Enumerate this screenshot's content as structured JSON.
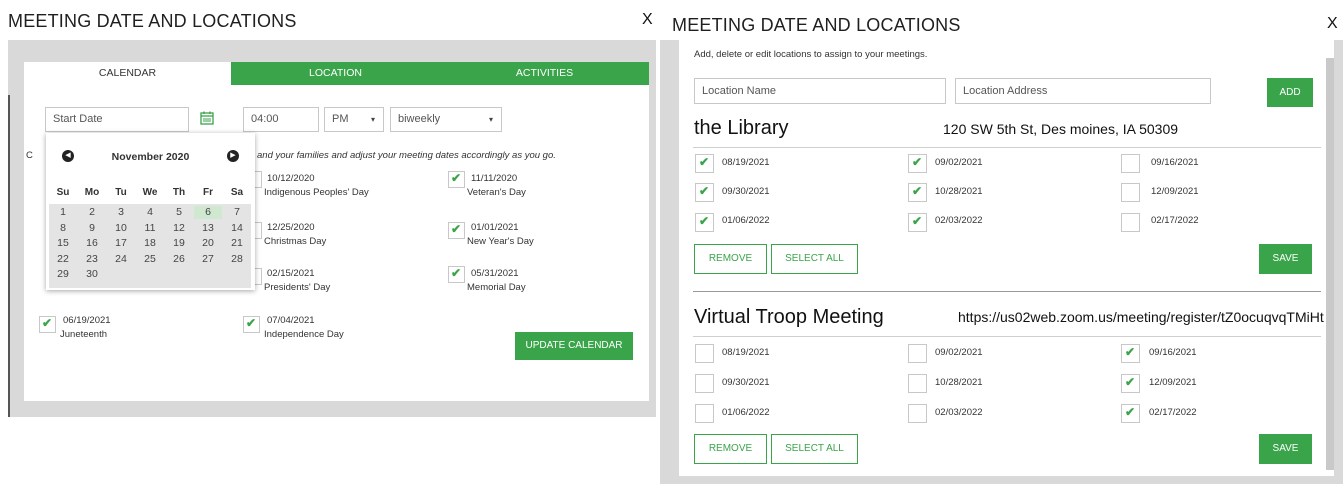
{
  "left": {
    "title": "MEETING DATE AND LOCATIONS",
    "close": "X",
    "tabs": [
      "CALENDAR",
      "LOCATION",
      "ACTIVITIES"
    ],
    "start_date_placeholder": "Start Date",
    "time": "04:00",
    "ampm": "PM",
    "frequency": "biweekly",
    "partial_c": "C",
    "instructions_partial": "and your families and adjust your meeting dates accordingly as you go.",
    "calendar": {
      "month": "November 2020",
      "dow": [
        "Su",
        "Mo",
        "Tu",
        "We",
        "Th",
        "Fr",
        "Sa"
      ],
      "weeks": [
        [
          "1",
          "2",
          "3",
          "4",
          "5",
          "6",
          "7"
        ],
        [
          "8",
          "9",
          "10",
          "11",
          "12",
          "13",
          "14"
        ],
        [
          "15",
          "16",
          "17",
          "18",
          "19",
          "20",
          "21"
        ],
        [
          "22",
          "23",
          "24",
          "25",
          "26",
          "27",
          "28"
        ],
        [
          "29",
          "30",
          "",
          "",
          "",
          "",
          ""
        ]
      ],
      "highlighted": "6"
    },
    "holidays": [
      {
        "date": "10/12/2020",
        "name": "Indigenous Peoples' Day",
        "checked": false
      },
      {
        "date": "11/11/2020",
        "name": "Veteran's Day",
        "checked": true
      },
      {
        "date": "12/25/2020",
        "name": "Christmas Day",
        "checked": false
      },
      {
        "date": "01/01/2021",
        "name": "New Year's Day",
        "checked": true
      },
      {
        "date": "02/15/2021",
        "name": "Presidents' Day",
        "checked": false
      },
      {
        "date": "05/31/2021",
        "name": "Memorial Day",
        "checked": true
      },
      {
        "date": "06/19/2021",
        "name": "Juneteenth",
        "checked": true
      },
      {
        "date": "07/04/2021",
        "name": "Independence Day",
        "checked": true
      }
    ],
    "update_button": "UPDATE CALENDAR"
  },
  "right": {
    "title": "MEETING DATE AND LOCATIONS",
    "close": "X",
    "subtitle": "Add, delete or edit locations to assign to your meetings.",
    "location_name_placeholder": "Location Name",
    "location_address_placeholder": "Location Address",
    "add_button": "ADD",
    "locations": [
      {
        "name": "the Library",
        "address": "120 SW 5th St, Des moines, IA 50309",
        "dates": [
          {
            "date": "08/19/2021",
            "checked": true
          },
          {
            "date": "09/02/2021",
            "checked": true
          },
          {
            "date": "09/16/2021",
            "checked": false
          },
          {
            "date": "09/30/2021",
            "checked": true
          },
          {
            "date": "10/28/2021",
            "checked": true
          },
          {
            "date": "12/09/2021",
            "checked": false
          },
          {
            "date": "01/06/2022",
            "checked": true
          },
          {
            "date": "02/03/2022",
            "checked": true
          },
          {
            "date": "02/17/2022",
            "checked": false
          }
        ],
        "remove": "REMOVE",
        "select_all": "SELECT ALL",
        "save": "SAVE"
      },
      {
        "name": "Virtual Troop Meeting",
        "address": "https://us02web.zoom.us/meeting/register/tZ0ocuqvqTMiHt",
        "dates": [
          {
            "date": "08/19/2021",
            "checked": false
          },
          {
            "date": "09/02/2021",
            "checked": false
          },
          {
            "date": "09/16/2021",
            "checked": true
          },
          {
            "date": "09/30/2021",
            "checked": false
          },
          {
            "date": "10/28/2021",
            "checked": false
          },
          {
            "date": "12/09/2021",
            "checked": true
          },
          {
            "date": "01/06/2022",
            "checked": false
          },
          {
            "date": "02/03/2022",
            "checked": false
          },
          {
            "date": "02/17/2022",
            "checked": true
          }
        ],
        "remove": "REMOVE",
        "select_all": "SELECT ALL",
        "save": "SAVE"
      }
    ]
  },
  "colors": {
    "accent": "#3aa44a",
    "backdrop": "#d9d9d9"
  }
}
